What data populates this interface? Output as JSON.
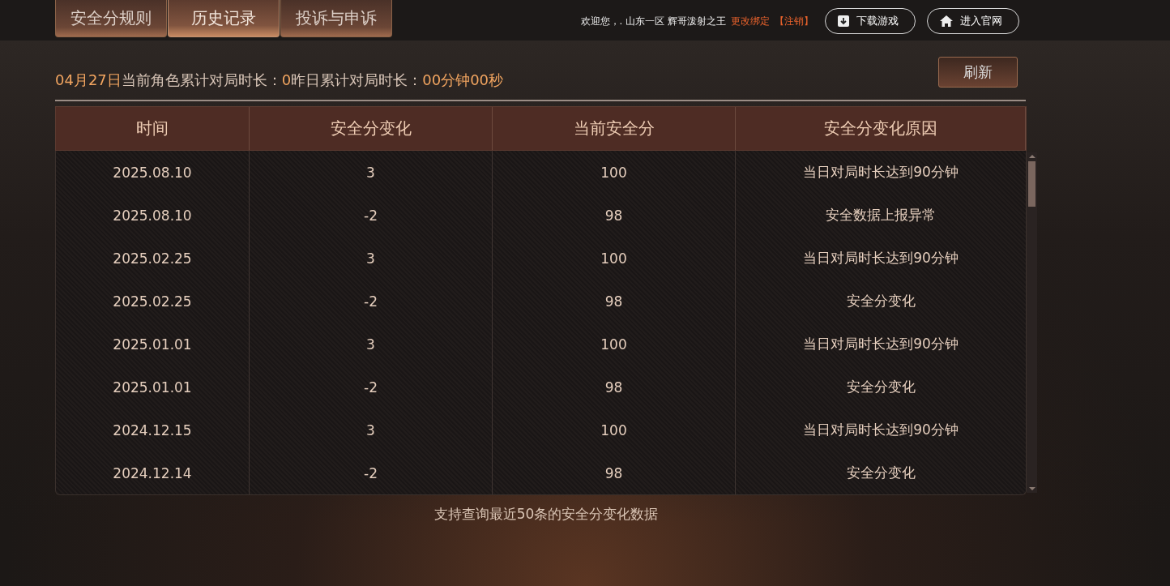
{
  "tabs": [
    {
      "label": "安全分规则",
      "selected": false
    },
    {
      "label": "历史记录",
      "selected": true
    },
    {
      "label": "投诉与申诉",
      "selected": false
    }
  ],
  "user_bar": {
    "welcome": "欢迎您，. 山东一区 辉哥泼射之王",
    "change_binding": "更改绑定",
    "logout": "【注销】",
    "buttons": [
      {
        "kind": "download",
        "label": "下载游戏"
      },
      {
        "kind": "home",
        "label": "进入官网"
      }
    ]
  },
  "summary": {
    "date": "04月27日",
    "current_label": "当前角色累计对局时长：",
    "current_value": "0",
    "yesterday_label": "昨日累计对局时长：",
    "yesterday_value": "00分钟00秒"
  },
  "refresh_button": "刷新",
  "table": {
    "columns": [
      "时间",
      "安全分变化",
      "当前安全分",
      "安全分变化原因"
    ],
    "rows": [
      [
        "2025.08.10",
        "3",
        "100",
        "当日对局时长达到90分钟"
      ],
      [
        "2025.08.10",
        "-2",
        "98",
        "安全数据上报异常"
      ],
      [
        "2025.02.25",
        "3",
        "100",
        "当日对局时长达到90分钟"
      ],
      [
        "2025.02.25",
        "-2",
        "98",
        "安全分变化"
      ],
      [
        "2025.01.01",
        "3",
        "100",
        "当日对局时长达到90分钟"
      ],
      [
        "2025.01.01",
        "-2",
        "98",
        "安全分变化"
      ],
      [
        "2024.12.15",
        "3",
        "100",
        "当日对局时长达到90分钟"
      ],
      [
        "2024.12.14",
        "-2",
        "98",
        "安全分变化"
      ]
    ]
  },
  "footer_note": "支持查询最近50条的安全分变化数据"
}
